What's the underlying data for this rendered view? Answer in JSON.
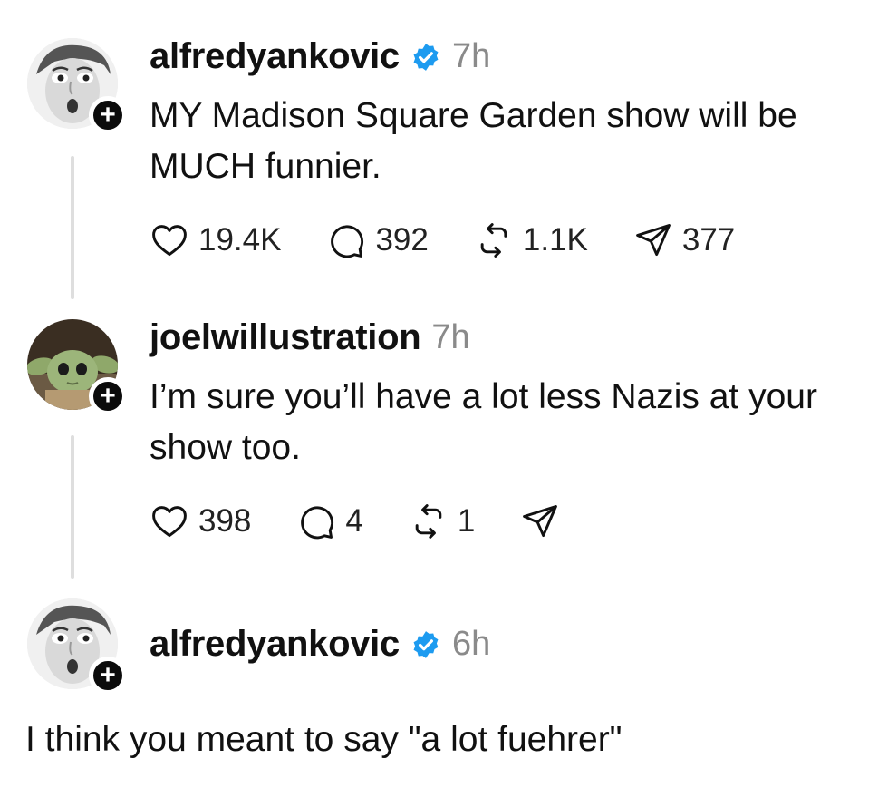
{
  "posts": [
    {
      "username": "alfredyankovic",
      "time": "7h",
      "verified": true,
      "text": "MY Madison Square Garden show will be MUCH funnier.",
      "likes": "19.4K",
      "replies": "392",
      "reposts": "1.1K",
      "shares": "377"
    },
    {
      "username": "joelwillustration",
      "time": "7h",
      "verified": false,
      "text": "I’m sure you’ll have a lot less Nazis at your show too.",
      "likes": "398",
      "replies": "4",
      "reposts": "1",
      "shares": ""
    },
    {
      "username": "alfredyankovic",
      "time": "6h",
      "verified": true,
      "text": "I think you meant to say \"a lot fuehrer\""
    }
  ],
  "icons": {
    "like": "heart-icon",
    "reply": "comment-icon",
    "repost": "repost-icon",
    "share": "send-icon",
    "follow": "plus-icon",
    "verified": "verified-badge-icon"
  },
  "colors": {
    "verified": "#1d9bf0",
    "muted_text": "#8a8a8a",
    "thread_line": "#dedede"
  }
}
